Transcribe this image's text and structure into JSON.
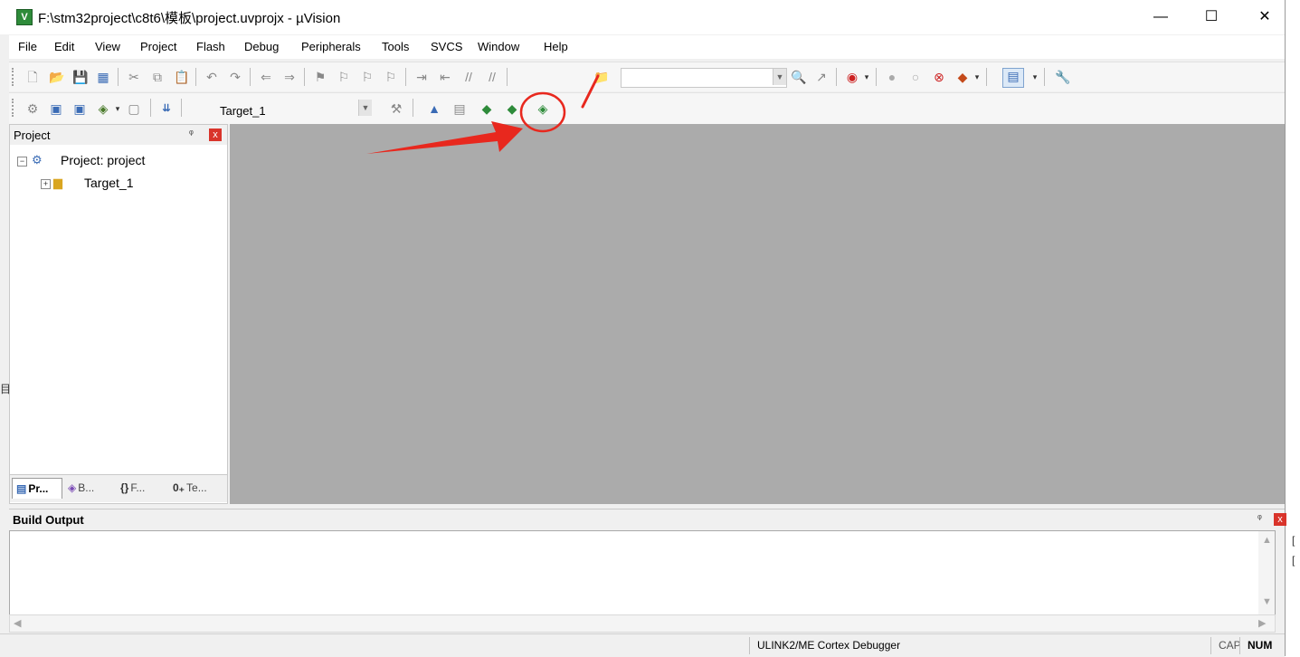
{
  "window": {
    "title": "F:\\stm32project\\c8t6\\模板\\project.uvprojx - µVision",
    "app_icon": "V",
    "controls": {
      "minimize": "—",
      "maximize": "☐",
      "close": "✕"
    }
  },
  "menu": [
    "File",
    "Edit",
    "View",
    "Project",
    "Flash",
    "Debug",
    "Peripherals",
    "Tools",
    "SVCS",
    "Window",
    "Help"
  ],
  "toolbar2": {
    "target_select": "Target_1"
  },
  "project_panel": {
    "title": "Project",
    "pin": "ᵠ",
    "close": "x",
    "tree": {
      "root": "Project: project",
      "child": "Target_1"
    },
    "tabs": [
      "Pr...",
      "B...",
      "F...",
      "Te..."
    ]
  },
  "build_output": {
    "title": "Build Output",
    "pin": "ᵠ",
    "close": "x"
  },
  "status": {
    "debugger": "ULINK2/ME Cortex Debugger",
    "cap": "CAP",
    "num": "NUM"
  },
  "colors": {
    "workspace": "#ababab",
    "annotation": "#e8281e",
    "close_button": "#d9342b"
  },
  "edge_glyphs": {
    "left": "目",
    "right1": "[",
    "right2": "["
  }
}
